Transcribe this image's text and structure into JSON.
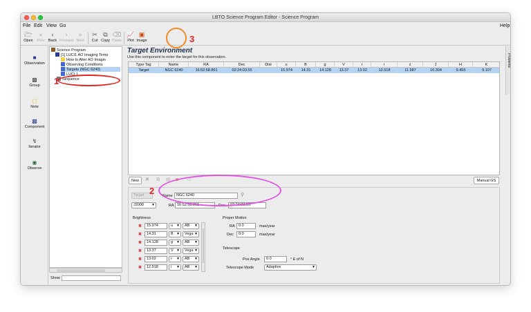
{
  "window": {
    "title": "LBTO Science Program Editor - Science Program"
  },
  "menu": {
    "items": [
      "File",
      "Edit",
      "View",
      "Go"
    ],
    "help": "Help"
  },
  "toolbar": {
    "open": "Open",
    "prev": "Prev",
    "back": "Back",
    "forward": "Forward",
    "next": "Next",
    "cut": "Cut",
    "copy": "Copy",
    "paste": "Paste",
    "plot": "Plot",
    "image": "Image"
  },
  "palette": {
    "observation": "Observation",
    "group": "Group",
    "note": "Note",
    "component": "Component",
    "iterator": "Iterator",
    "observe": "Observe"
  },
  "tree": {
    "items": [
      "Science Program",
      "[1] LUCI1 AO Imaging Temp",
      "How to Alter AO Imagin",
      "Observing Conditions",
      "Targets (NGC 6240)",
      "LUCI 1",
      "Sequence"
    ],
    "show_label": "Show"
  },
  "problems_tab": "Problems",
  "editor": {
    "title": "Target Environment",
    "subtitle": "Use this component to enter the target for this observation.",
    "table": {
      "headers": [
        "Type Tag",
        "Name",
        "RA",
        "Dec",
        "Dist",
        "u",
        "B",
        "g",
        "V",
        "r",
        "i",
        "z",
        "J",
        "H",
        "K"
      ],
      "row": [
        "Target",
        "NGC 6240",
        "16:52:58.861",
        "02:24:03.55",
        "",
        "15.974",
        "14.31",
        "14.128",
        "13.37",
        "13.02",
        "12.518",
        "11.987",
        "10.304",
        "9.455",
        "9.107"
      ]
    },
    "new_button": "New",
    "manual_gs_button": "Manual GS"
  },
  "target_form": {
    "target_tag": "Target",
    "epoch": "J2000",
    "name_label": "Name",
    "name_value": "NGC 6240",
    "ra_label": "RA",
    "ra_value": "16:52:58.861",
    "dec_label": "Dec",
    "dec_value": "02:24:03.55"
  },
  "brightness": {
    "label": "Brightness",
    "rows": [
      {
        "value": "15.974",
        "band": "u",
        "system": "AB"
      },
      {
        "value": "14.31",
        "band": "B",
        "system": "Vega"
      },
      {
        "value": "14.128",
        "band": "g",
        "system": "AB"
      },
      {
        "value": "13.37",
        "band": "V",
        "system": "Vega"
      },
      {
        "value": "13.02",
        "band": "r",
        "system": "AB"
      },
      {
        "value": "12.518",
        "band": "i",
        "system": "AB"
      }
    ]
  },
  "proper_motion": {
    "label": "Proper Motion",
    "ra_label": "RA",
    "ra_value": "0.0",
    "ra_unit": "mas/year",
    "dec_label": "Dec",
    "dec_value": "0.0",
    "dec_unit": "mas/year"
  },
  "telescope": {
    "label": "Telescope",
    "pos_angle_label": "Pos Angle",
    "pos_angle_value": "0.0",
    "pos_angle_unit": "° E of N",
    "mode_label": "Telescope Mode",
    "mode_value": "Adaptive"
  },
  "annotations": {
    "n1": "1",
    "n2": "2",
    "n3": "3",
    "color_red": "#e02424",
    "color_magenta": "#e052e0",
    "color_orange": "#f08c2a"
  }
}
